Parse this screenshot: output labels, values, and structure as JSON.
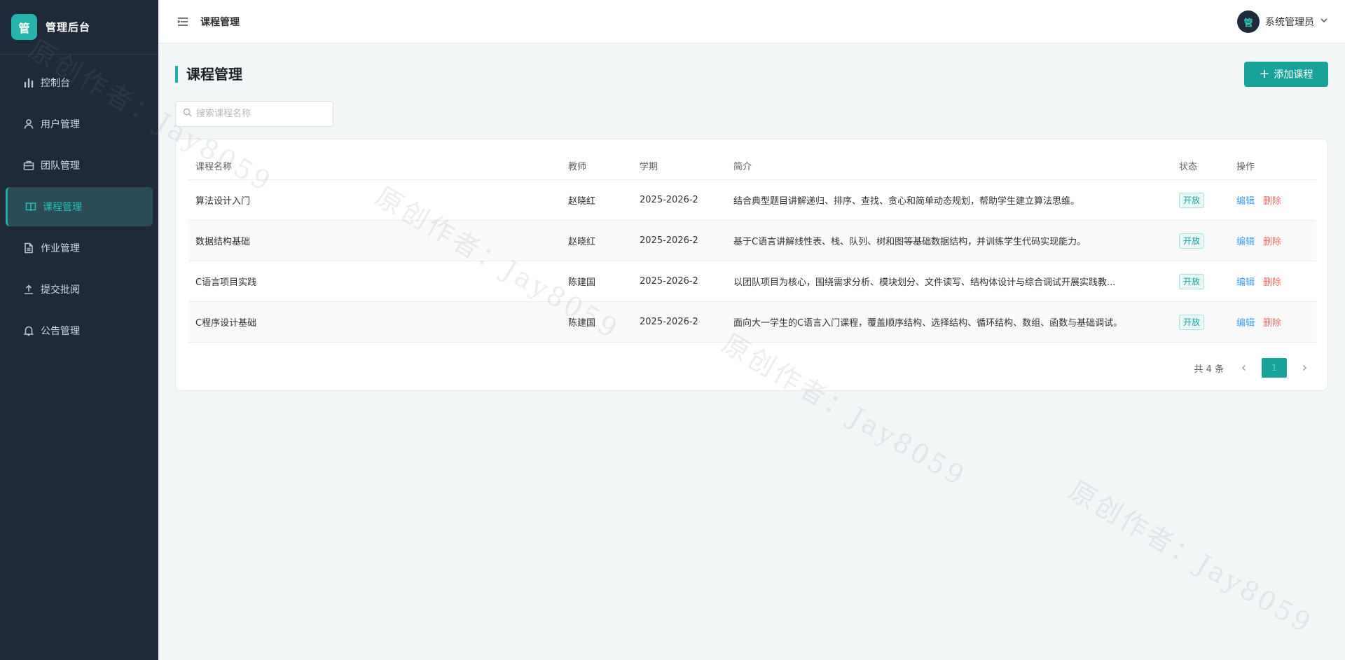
{
  "brand": {
    "logo_char": "管",
    "title": "管理后台"
  },
  "sidebar": {
    "items": [
      {
        "label": "控制台",
        "icon": "bar-chart-icon",
        "active": false
      },
      {
        "label": "用户管理",
        "icon": "user-icon",
        "active": false
      },
      {
        "label": "团队管理",
        "icon": "briefcase-icon",
        "active": false
      },
      {
        "label": "课程管理",
        "icon": "book-icon",
        "active": true
      },
      {
        "label": "作业管理",
        "icon": "document-icon",
        "active": false
      },
      {
        "label": "提交批阅",
        "icon": "upload-icon",
        "active": false
      },
      {
        "label": "公告管理",
        "icon": "bell-icon",
        "active": false
      }
    ]
  },
  "header": {
    "title": "课程管理",
    "user": {
      "avatar_char": "管",
      "name": "系统管理员"
    }
  },
  "main": {
    "page_title": "课程管理",
    "add_button": "添加课程",
    "search_placeholder": "搜索课程名称",
    "table": {
      "columns": [
        "课程名称",
        "教师",
        "学期",
        "简介",
        "状态",
        "操作"
      ],
      "rows": [
        {
          "name": "算法设计入门",
          "teacher": "赵晓红",
          "term": "2025-2026-2",
          "intro": "结合典型题目讲解递归、排序、查找、贪心和简单动态规划，帮助学生建立算法思维。",
          "status": "开放",
          "edit": "编辑",
          "delete": "删除"
        },
        {
          "name": "数据结构基础",
          "teacher": "赵晓红",
          "term": "2025-2026-2",
          "intro": "基于C语言讲解线性表、栈、队列、树和图等基础数据结构，并训练学生代码实现能力。",
          "status": "开放",
          "edit": "编辑",
          "delete": "删除"
        },
        {
          "name": "C语言项目实践",
          "teacher": "陈建国",
          "term": "2025-2026-2",
          "intro": "以团队项目为核心，围绕需求分析、模块划分、文件读写、结构体设计与综合调试开展实践教...",
          "status": "开放",
          "edit": "编辑",
          "delete": "删除"
        },
        {
          "name": "C程序设计基础",
          "teacher": "陈建国",
          "term": "2025-2026-2",
          "intro": "面向大一学生的C语言入门课程，覆盖顺序结构、选择结构、循环结构、数组、函数与基础调试。",
          "status": "开放",
          "edit": "编辑",
          "delete": "删除"
        }
      ]
    },
    "pagination": {
      "total_text": "共 4 条",
      "current_page": "1"
    }
  },
  "watermark": "原创作者：Jay8059"
}
